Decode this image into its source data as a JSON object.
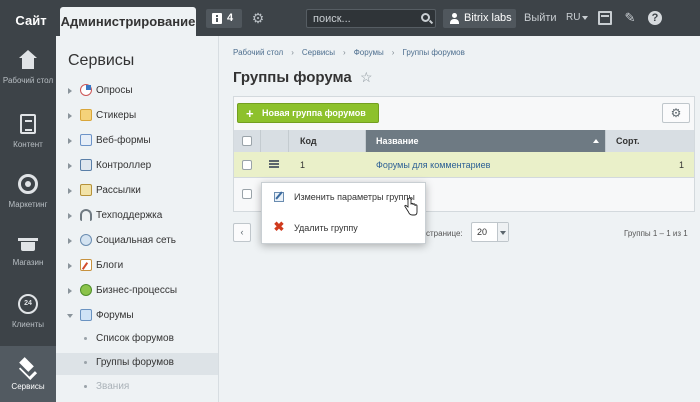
{
  "topbar": {
    "site_tab": "Сайт",
    "admin_tab": "Администрирование",
    "notifications_count": "4",
    "search_placeholder": "поиск...",
    "user_name": "Bitrix labs",
    "logout": "Выйти",
    "language": "RU"
  },
  "leftbar": {
    "items": [
      {
        "label": "Рабочий стол",
        "icon": "home-icon"
      },
      {
        "label": "Контент",
        "icon": "document-icon"
      },
      {
        "label": "Маркетинг",
        "icon": "target-icon"
      },
      {
        "label": "Магазин",
        "icon": "basket-icon"
      },
      {
        "label": "Клиенты",
        "icon": "clock-24-icon"
      },
      {
        "label": "Сервисы",
        "icon": "layers-icon",
        "active": true
      }
    ]
  },
  "sidebar": {
    "title": "Сервисы",
    "items": [
      {
        "label": "Опросы"
      },
      {
        "label": "Стикеры"
      },
      {
        "label": "Веб-формы"
      },
      {
        "label": "Контроллер"
      },
      {
        "label": "Рассылки"
      },
      {
        "label": "Техподдержка"
      },
      {
        "label": "Социальная сеть"
      },
      {
        "label": "Блоги"
      },
      {
        "label": "Бизнес-процессы"
      },
      {
        "label": "Форумы",
        "expanded": true
      }
    ],
    "subitems": [
      {
        "label": "Список форумов"
      },
      {
        "label": "Группы форумов",
        "selected": true
      },
      {
        "label": "Звания"
      }
    ]
  },
  "breadcrumb": [
    "Рабочий стол",
    "Сервисы",
    "Форумы",
    "Группы форумов"
  ],
  "page": {
    "title": "Группы форума"
  },
  "toolbar": {
    "new_button": "Новая группа форумов"
  },
  "grid": {
    "columns": [
      "Код",
      "Название",
      "Сорт."
    ],
    "rows": [
      {
        "code": "1",
        "name": "Форумы для комментариев",
        "sort": "1"
      }
    ]
  },
  "context_menu": {
    "items": [
      {
        "label": "Изменить параметры группы",
        "icon": "edit-icon"
      },
      {
        "label": "Удалить группу",
        "icon": "delete-icon"
      }
    ]
  },
  "pager": {
    "per_page_label": "странице:",
    "per_page_value": "20",
    "total": "Группы 1 – 1 из 1"
  },
  "colors": {
    "topbar": "#3d4348",
    "accent_green": "#8dc12c",
    "selected_row": "#eaf0c9",
    "link": "#2c5f95",
    "active_column": "#6e7a83"
  }
}
